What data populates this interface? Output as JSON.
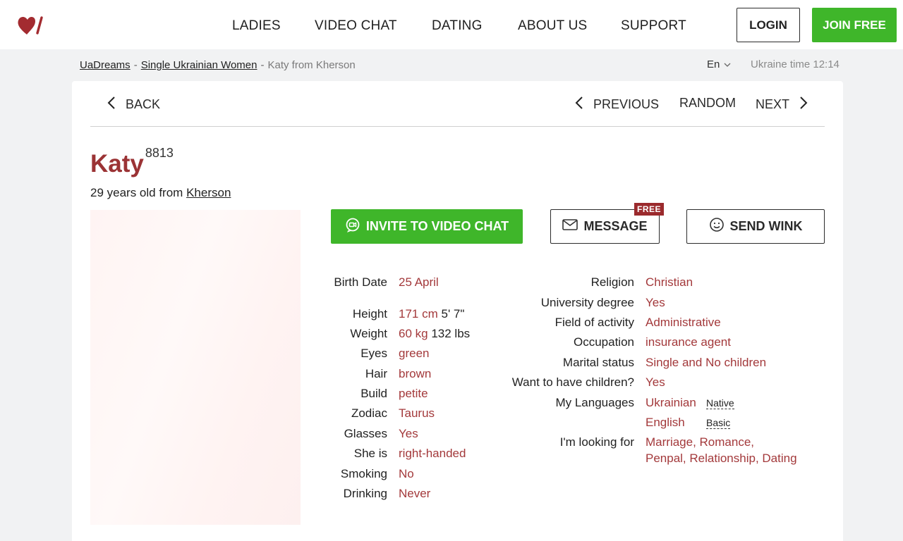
{
  "header": {
    "logo_icon": "heart-slash-logo",
    "nav": [
      "LADIES",
      "VIDEO CHAT",
      "DATING",
      "ABOUT US",
      "SUPPORT"
    ],
    "login_label": "LOGIN",
    "join_label": "JOIN FREE"
  },
  "breadcrumb": {
    "home": "UaDreams",
    "sep": "-",
    "section": "Single Ukrainian Women",
    "current": "Katy from Kherson"
  },
  "language": "En",
  "ukraine_time": "Ukraine time 12:14",
  "pager": {
    "back": "BACK",
    "previous": "PREVIOUS",
    "random": "RANDOM",
    "next": "NEXT"
  },
  "profile": {
    "name": "Katy",
    "id": "8813",
    "age_text": "29 years old from",
    "city": "Kherson"
  },
  "actions": {
    "invite": "INVITE TO VIDEO CHAT",
    "message": "MESSAGE",
    "free_badge": "FREE",
    "wink": "SEND WINK"
  },
  "details_left": [
    {
      "label": "Birth Date",
      "value": "25 April"
    },
    {
      "label": "Height",
      "value": "171 cm",
      "alt": "5' 7\""
    },
    {
      "label": "Weight",
      "value": "60 kg",
      "alt": "132 lbs"
    },
    {
      "label": "Eyes",
      "value": "green"
    },
    {
      "label": "Hair",
      "value": "brown"
    },
    {
      "label": "Build",
      "value": "petite"
    },
    {
      "label": "Zodiac",
      "value": "Taurus"
    },
    {
      "label": "Glasses",
      "value": "Yes"
    },
    {
      "label": "She is",
      "value": "right-handed"
    },
    {
      "label": "Smoking",
      "value": "No"
    },
    {
      "label": "Drinking",
      "value": "Never"
    }
  ],
  "details_right": [
    {
      "label": "Religion",
      "value": "Christian"
    },
    {
      "label": "University degree",
      "value": "Yes"
    },
    {
      "label": "Field of activity",
      "value": "Administrative"
    },
    {
      "label": "Occupation",
      "value": "insurance agent"
    },
    {
      "label": "Marital status",
      "value": "Single and No children"
    },
    {
      "label": "Want to have children?",
      "value": "Yes"
    },
    {
      "label": "My Languages",
      "value": "Ukrainian",
      "level": "Native"
    },
    {
      "label": "",
      "value": "English",
      "level": "Basic"
    },
    {
      "label": "I'm looking for",
      "value": "Marriage, Romance,",
      "value2": "Penpal, Relationship, Dating"
    }
  ],
  "colors": {
    "accent_red": "#9b3335",
    "value_red": "#a3393b",
    "green": "#3fb62a"
  }
}
